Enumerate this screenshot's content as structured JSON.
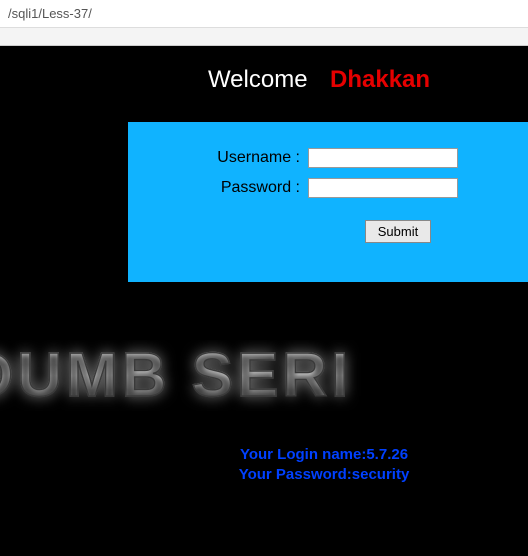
{
  "address": "/sqli1/Less-37/",
  "header": {
    "welcome": "Welcome",
    "name": "Dhakkan"
  },
  "form": {
    "username_label": "Username :",
    "password_label": "Password :",
    "username_value": "",
    "password_value": "",
    "submit_label": "Submit"
  },
  "banner": "I DUMB SERI",
  "result": {
    "line1": "Your Login name:5.7.26",
    "line2": "Your Password:security"
  }
}
